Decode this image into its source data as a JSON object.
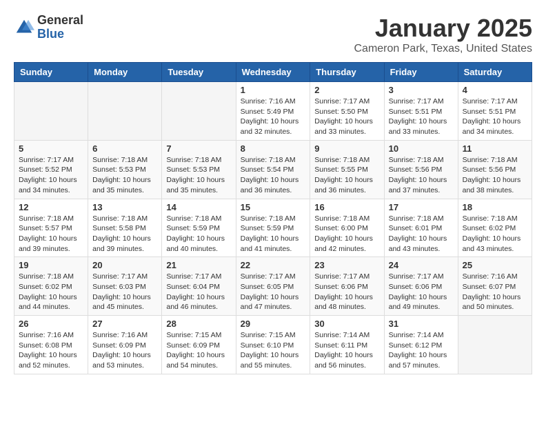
{
  "header": {
    "logo_general": "General",
    "logo_blue": "Blue",
    "title": "January 2025",
    "subtitle": "Cameron Park, Texas, United States"
  },
  "weekdays": [
    "Sunday",
    "Monday",
    "Tuesday",
    "Wednesday",
    "Thursday",
    "Friday",
    "Saturday"
  ],
  "weeks": [
    [
      {
        "day": "",
        "info": ""
      },
      {
        "day": "",
        "info": ""
      },
      {
        "day": "",
        "info": ""
      },
      {
        "day": "1",
        "info": "Sunrise: 7:16 AM\nSunset: 5:49 PM\nDaylight: 10 hours\nand 32 minutes."
      },
      {
        "day": "2",
        "info": "Sunrise: 7:17 AM\nSunset: 5:50 PM\nDaylight: 10 hours\nand 33 minutes."
      },
      {
        "day": "3",
        "info": "Sunrise: 7:17 AM\nSunset: 5:51 PM\nDaylight: 10 hours\nand 33 minutes."
      },
      {
        "day": "4",
        "info": "Sunrise: 7:17 AM\nSunset: 5:51 PM\nDaylight: 10 hours\nand 34 minutes."
      }
    ],
    [
      {
        "day": "5",
        "info": "Sunrise: 7:17 AM\nSunset: 5:52 PM\nDaylight: 10 hours\nand 34 minutes."
      },
      {
        "day": "6",
        "info": "Sunrise: 7:18 AM\nSunset: 5:53 PM\nDaylight: 10 hours\nand 35 minutes."
      },
      {
        "day": "7",
        "info": "Sunrise: 7:18 AM\nSunset: 5:53 PM\nDaylight: 10 hours\nand 35 minutes."
      },
      {
        "day": "8",
        "info": "Sunrise: 7:18 AM\nSunset: 5:54 PM\nDaylight: 10 hours\nand 36 minutes."
      },
      {
        "day": "9",
        "info": "Sunrise: 7:18 AM\nSunset: 5:55 PM\nDaylight: 10 hours\nand 36 minutes."
      },
      {
        "day": "10",
        "info": "Sunrise: 7:18 AM\nSunset: 5:56 PM\nDaylight: 10 hours\nand 37 minutes."
      },
      {
        "day": "11",
        "info": "Sunrise: 7:18 AM\nSunset: 5:56 PM\nDaylight: 10 hours\nand 38 minutes."
      }
    ],
    [
      {
        "day": "12",
        "info": "Sunrise: 7:18 AM\nSunset: 5:57 PM\nDaylight: 10 hours\nand 39 minutes."
      },
      {
        "day": "13",
        "info": "Sunrise: 7:18 AM\nSunset: 5:58 PM\nDaylight: 10 hours\nand 39 minutes."
      },
      {
        "day": "14",
        "info": "Sunrise: 7:18 AM\nSunset: 5:59 PM\nDaylight: 10 hours\nand 40 minutes."
      },
      {
        "day": "15",
        "info": "Sunrise: 7:18 AM\nSunset: 5:59 PM\nDaylight: 10 hours\nand 41 minutes."
      },
      {
        "day": "16",
        "info": "Sunrise: 7:18 AM\nSunset: 6:00 PM\nDaylight: 10 hours\nand 42 minutes."
      },
      {
        "day": "17",
        "info": "Sunrise: 7:18 AM\nSunset: 6:01 PM\nDaylight: 10 hours\nand 43 minutes."
      },
      {
        "day": "18",
        "info": "Sunrise: 7:18 AM\nSunset: 6:02 PM\nDaylight: 10 hours\nand 43 minutes."
      }
    ],
    [
      {
        "day": "19",
        "info": "Sunrise: 7:18 AM\nSunset: 6:02 PM\nDaylight: 10 hours\nand 44 minutes."
      },
      {
        "day": "20",
        "info": "Sunrise: 7:17 AM\nSunset: 6:03 PM\nDaylight: 10 hours\nand 45 minutes."
      },
      {
        "day": "21",
        "info": "Sunrise: 7:17 AM\nSunset: 6:04 PM\nDaylight: 10 hours\nand 46 minutes."
      },
      {
        "day": "22",
        "info": "Sunrise: 7:17 AM\nSunset: 6:05 PM\nDaylight: 10 hours\nand 47 minutes."
      },
      {
        "day": "23",
        "info": "Sunrise: 7:17 AM\nSunset: 6:06 PM\nDaylight: 10 hours\nand 48 minutes."
      },
      {
        "day": "24",
        "info": "Sunrise: 7:17 AM\nSunset: 6:06 PM\nDaylight: 10 hours\nand 49 minutes."
      },
      {
        "day": "25",
        "info": "Sunrise: 7:16 AM\nSunset: 6:07 PM\nDaylight: 10 hours\nand 50 minutes."
      }
    ],
    [
      {
        "day": "26",
        "info": "Sunrise: 7:16 AM\nSunset: 6:08 PM\nDaylight: 10 hours\nand 52 minutes."
      },
      {
        "day": "27",
        "info": "Sunrise: 7:16 AM\nSunset: 6:09 PM\nDaylight: 10 hours\nand 53 minutes."
      },
      {
        "day": "28",
        "info": "Sunrise: 7:15 AM\nSunset: 6:09 PM\nDaylight: 10 hours\nand 54 minutes."
      },
      {
        "day": "29",
        "info": "Sunrise: 7:15 AM\nSunset: 6:10 PM\nDaylight: 10 hours\nand 55 minutes."
      },
      {
        "day": "30",
        "info": "Sunrise: 7:14 AM\nSunset: 6:11 PM\nDaylight: 10 hours\nand 56 minutes."
      },
      {
        "day": "31",
        "info": "Sunrise: 7:14 AM\nSunset: 6:12 PM\nDaylight: 10 hours\nand 57 minutes."
      },
      {
        "day": "",
        "info": ""
      }
    ]
  ]
}
